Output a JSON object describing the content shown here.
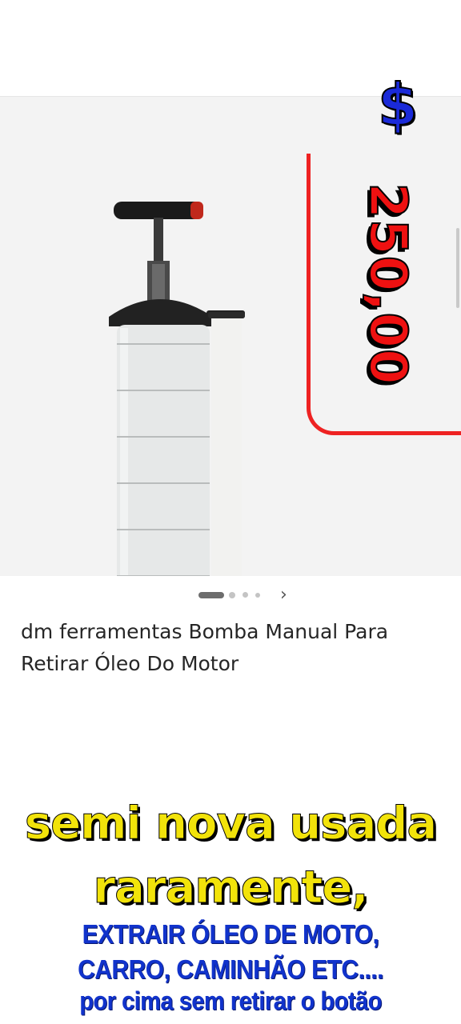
{
  "listing": {
    "currency_symbol": "$",
    "price": "250,00",
    "title": "dm ferramentas Bomba Manual Para Retirar Óleo Do Motor",
    "carousel": {
      "total_images": 4,
      "active_index": 1,
      "next_glyph": "›"
    }
  },
  "promo": {
    "headline_line1": "semi nova usada",
    "headline_line2": "raramente,",
    "detail_line1": "EXTRAIR ÓLEO DE MOTO,",
    "detail_line2": "CARRO, CAMINHÃO ETC....",
    "detail_line3": "por cima sem retirar o botão"
  },
  "colors": {
    "price_red": "#ee1111",
    "dollar_blue": "#1a2ad8",
    "headline_yellow": "#f2e30a",
    "detail_blue": "#1133cc"
  },
  "icons": {
    "next": "chevron-right-icon",
    "product": "manual-oil-extractor-pump"
  }
}
